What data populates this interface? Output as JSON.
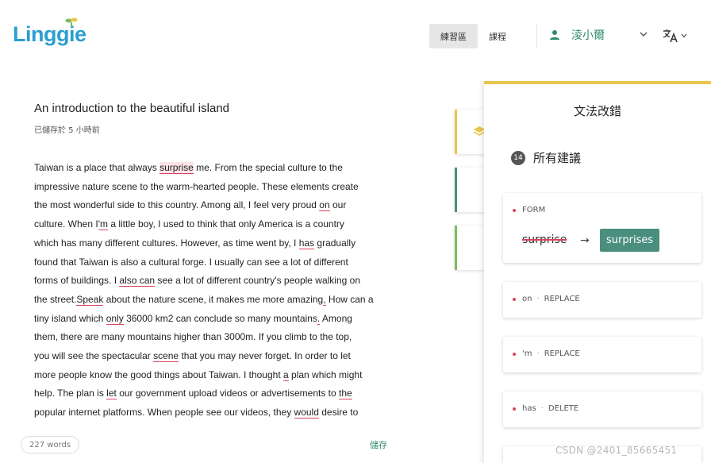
{
  "header": {
    "logo_text": "Lingg e",
    "nav": [
      {
        "label": "練習區",
        "active": true
      },
      {
        "label": "課程",
        "active": false
      }
    ],
    "user_name": "淩小爾"
  },
  "editor": {
    "title": "An introduction to the beautiful island",
    "saved_status": "已儲存於 5 小時前",
    "word_count": "227 words",
    "save_label": "儲存",
    "body": [
      [
        {
          "t": "Taiwan is a place that always "
        },
        {
          "t": "surprise",
          "e": "hl"
        },
        {
          "t": " me. From the special culture to the"
        }
      ],
      [
        {
          "t": "impressive nature scene to the warm-hearted people. These elements create"
        }
      ],
      [
        {
          "t": "the most wonderful side to this country. Among all, I feel very proud "
        },
        {
          "t": "on",
          "e": "u"
        },
        {
          "t": " our"
        }
      ],
      [
        {
          "t": "culture. When I"
        },
        {
          "t": "'m",
          "e": "u"
        },
        {
          "t": " a little boy, I used to think that only America is a country"
        }
      ],
      [
        {
          "t": "which has many different cultures. However, as time went by, I "
        },
        {
          "t": "has",
          "e": "u"
        },
        {
          "t": " gradually"
        }
      ],
      [
        {
          "t": "found that Taiwan is also a cultural forge. I usually can see a lot of different"
        }
      ],
      [
        {
          "t": "forms of buildings. I "
        },
        {
          "t": "also can",
          "e": "u"
        },
        {
          "t": " see a lot of different country's people walking on"
        }
      ],
      [
        {
          "t": "the street."
        },
        {
          "t": "Speak",
          "e": "u"
        },
        {
          "t": " about the nature scene, it makes me more amazing"
        },
        {
          "t": ",",
          "e": "u"
        },
        {
          "t": " How can a"
        }
      ],
      [
        {
          "t": "tiny island which "
        },
        {
          "t": "only",
          "e": "u"
        },
        {
          "t": " 36000 km2 can conclude so many mountains"
        },
        {
          "t": ".",
          "e": "u"
        },
        {
          "t": " Among"
        }
      ],
      [
        {
          "t": "them, there are many mountains higher than 3000m. If you climb to the top,"
        }
      ],
      [
        {
          "t": "you will see the spectacular "
        },
        {
          "t": "scene",
          "e": "u"
        },
        {
          "t": " that you may never forget. In order to let"
        }
      ],
      [
        {
          "t": "more people know the good things about Taiwan. I thought "
        },
        {
          "t": "a",
          "e": "u"
        },
        {
          "t": " plan which might"
        }
      ],
      [
        {
          "t": "help. The plan is "
        },
        {
          "t": "let",
          "e": "u"
        },
        {
          "t": " our government upload videos or advertisements to "
        },
        {
          "t": "the",
          "e": "u"
        }
      ],
      [
        {
          "t": "popular internet platforms. When people see our videos, they "
        },
        {
          "t": "would",
          "e": "u"
        },
        {
          "t": " desire to"
        }
      ]
    ]
  },
  "panel": {
    "title": "文法改錯",
    "suggestion_count": "14",
    "all_suggestions_label": "所有建議",
    "expanded_card": {
      "type": "FORM",
      "original": "surprise",
      "arrow": "→",
      "suggestion": "surprises"
    },
    "cards": [
      {
        "word": "on",
        "sep": "·",
        "action": "REPLACE"
      },
      {
        "word": "'m",
        "sep": "·",
        "action": "REPLACE"
      },
      {
        "word": "has",
        "sep": "·",
        "action": "DELETE"
      }
    ]
  },
  "watermark": "CSDN @2401_85665451",
  "colors": {
    "brand_blue": "#2a9fd0",
    "green": "#2e8a6e",
    "suggestion_green": "#4a8f7e",
    "error_red": "#d9455b",
    "panel_accent": "#e9c54c",
    "tab_teal": "#4a8f7e",
    "tab_green": "#7dbb5b"
  }
}
